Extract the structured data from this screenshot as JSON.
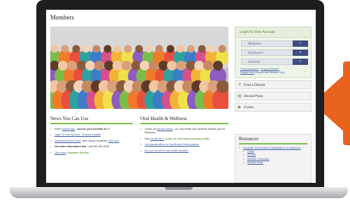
{
  "page_title": "Members",
  "sidebar": {
    "login_title": "Login To Your Account",
    "login_items": [
      {
        "label": "Members",
        "arrow": "»"
      },
      {
        "label": "Employers",
        "arrow": "»"
      },
      {
        "label": "Dentists",
        "arrow": "»"
      }
    ],
    "forgot_password": "Forgot password?",
    "forgot_username": "Forgot username?",
    "register_here": "Register here",
    "register_note": "(Dentists and Members Only)",
    "feature_buttons": [
      {
        "label": "Find a Dentist",
        "icon": "search-icon"
      },
      {
        "label": "Dental Plans",
        "icon": "document-icon"
      },
      {
        "label": "Forms",
        "icon": "play-icon"
      }
    ]
  },
  "news": {
    "title": "News You Can Use",
    "items": [
      {
        "pre": "FREE ",
        "link": "Mobile App",
        "post": " - Access your benefits 24-7!"
      },
      {
        "pre": "",
        "link": "Login To Your Account - Process Update",
        "post": ""
      },
      {
        "pre": "",
        "link": "Individual Dental Plans",
        "post": ". New Jersey residents, ",
        "link2": "click here"
      },
      {
        "pre": "",
        "bold": "Get claim information fast",
        "post": " - call 800-452-9310."
      },
      {
        "pre": "",
        "link": "Click here",
        "post": " Customer Service."
      }
    ]
  },
  "oral_health": {
    "title": "Oral Health & Wellness",
    "items": [
      {
        "pre": "Check out ",
        "link": "DentalCentral",
        "post": " - our oral health and wellness website just for Members"
      },
      {
        "pre": "Visit ",
        "link": "Dentist By 1",
        "post": ", a site for new moms and baby teeth."
      },
      {
        "pre": "",
        "link": "Get special offers on Oral-B and Crest products.",
        "post": ""
      },
      {
        "pre": "",
        "link": "Are you at risk for oral health disease?",
        "post": ""
      }
    ]
  },
  "resources": {
    "title": "Resources",
    "items": [
      {
        "link": "Nominate Your Dentist to Participate in our Networks!"
      },
      {
        "link": "Forms"
      },
      {
        "link": "ID Card"
      },
      {
        "link": "Benefits Connection"
      },
      {
        "link": "Member News"
      }
    ]
  },
  "colors": {
    "accent_orange": "#e8641e",
    "accent_green": "#7bbd4b",
    "button_blue": "#3f4d80",
    "link_blue": "#3959a5"
  }
}
